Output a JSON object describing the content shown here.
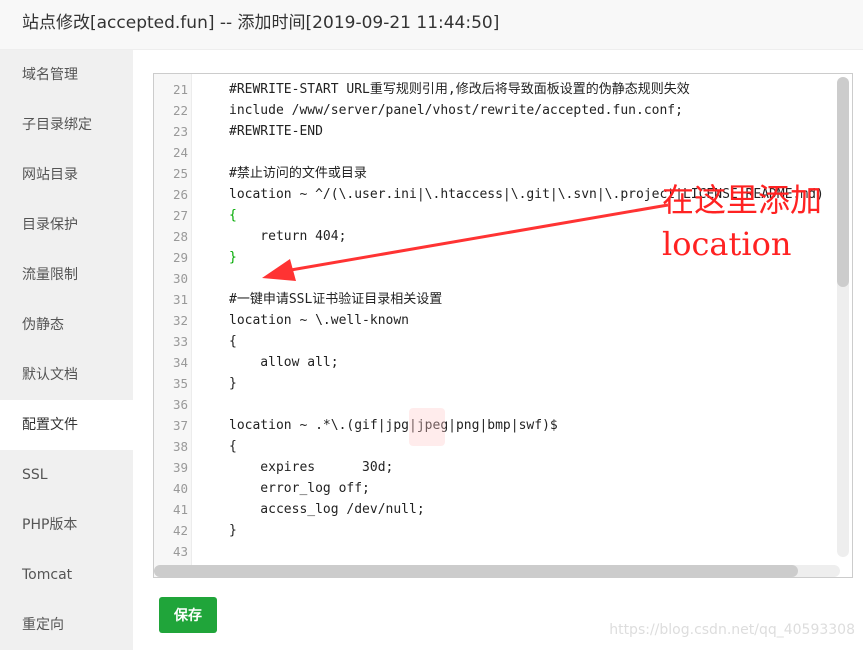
{
  "title": "站点修改[accepted.fun] -- 添加时间[2019-09-21 11:44:50]",
  "sidebar": {
    "items": [
      {
        "label": "域名管理"
      },
      {
        "label": "子目录绑定"
      },
      {
        "label": "网站目录"
      },
      {
        "label": "目录保护"
      },
      {
        "label": "流量限制"
      },
      {
        "label": "伪静态"
      },
      {
        "label": "默认文档"
      },
      {
        "label": "配置文件",
        "active": true
      },
      {
        "label": "SSL"
      },
      {
        "label": "PHP版本"
      },
      {
        "label": "Tomcat"
      },
      {
        "label": "重定向"
      }
    ]
  },
  "editor": {
    "lines": [
      {
        "n": "21",
        "text": "#REWRITE-START URL重写规则引用,修改后将导致面板设置的伪静态规则失效"
      },
      {
        "n": "22",
        "text": "include /www/server/panel/vhost/rewrite/accepted.fun.conf;"
      },
      {
        "n": "23",
        "text": "#REWRITE-END"
      },
      {
        "n": "24",
        "text": ""
      },
      {
        "n": "25",
        "text": "#禁止访问的文件或目录"
      },
      {
        "n": "26",
        "text": "location ~ ^/(\\.user.ini|\\.htaccess|\\.git|\\.svn|\\.project|LICENSE|README.md)"
      },
      {
        "n": "27",
        "text": "{",
        "kind": "brace"
      },
      {
        "n": "28",
        "text": "    return 404;"
      },
      {
        "n": "29",
        "text": "}",
        "kind": "brace"
      },
      {
        "n": "30",
        "text": ""
      },
      {
        "n": "31",
        "text": "#一键申请SSL证书验证目录相关设置"
      },
      {
        "n": "32",
        "text": "location ~ \\.well-known"
      },
      {
        "n": "33",
        "text": "{"
      },
      {
        "n": "34",
        "text": "    allow all;"
      },
      {
        "n": "35",
        "text": "}"
      },
      {
        "n": "36",
        "text": ""
      },
      {
        "n": "37",
        "text": "location ~ .*\\.(gif|jpg|jpeg|png|bmp|swf)$"
      },
      {
        "n": "38",
        "text": "{"
      },
      {
        "n": "39",
        "text": "    expires      30d;"
      },
      {
        "n": "40",
        "text": "    error_log off;"
      },
      {
        "n": "41",
        "text": "    access_log /dev/null;"
      },
      {
        "n": "42",
        "text": "}"
      },
      {
        "n": "43",
        "text": ""
      }
    ]
  },
  "annotation": {
    "line1": "在这里添加",
    "line2": "location",
    "color": "#ff3333"
  },
  "save_label": "保存",
  "watermark": "https://blog.csdn.net/qq_40593308",
  "colors": {
    "accent": "#20a53a"
  }
}
